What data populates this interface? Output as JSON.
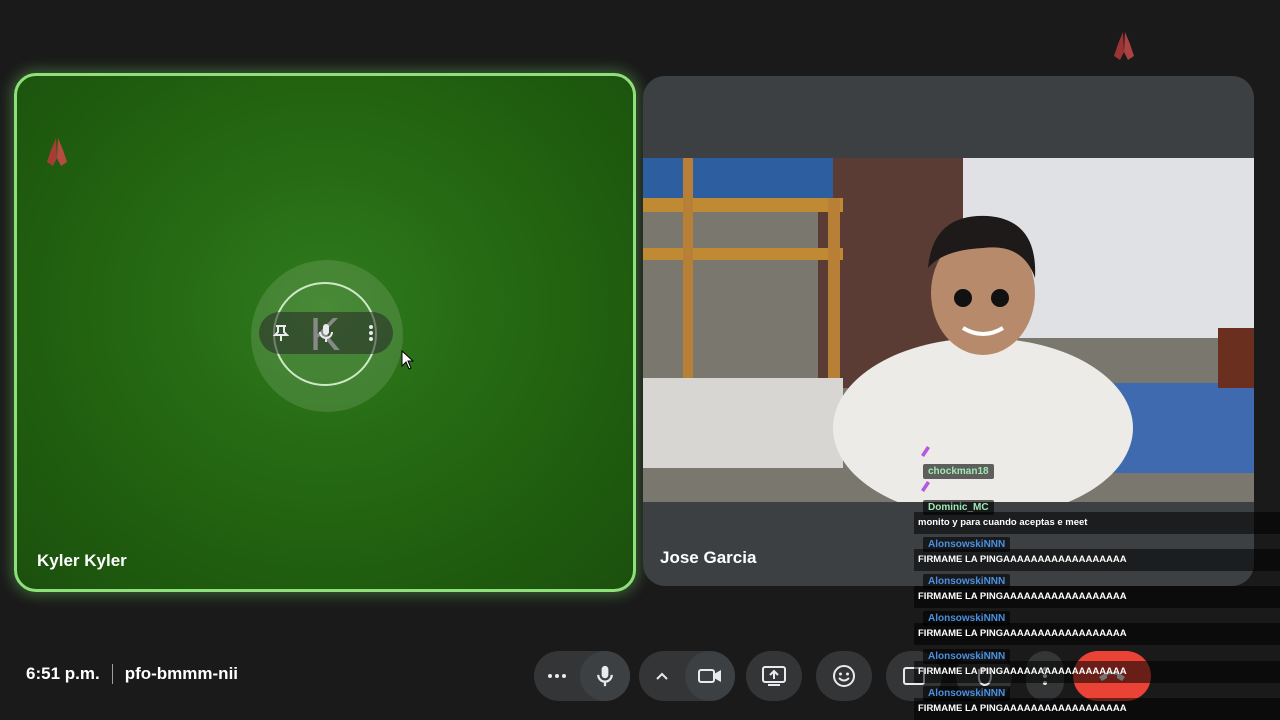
{
  "participants": [
    {
      "name": "Kyler Kyler",
      "initial": "K"
    },
    {
      "name": "Jose Garcia"
    }
  ],
  "meeting": {
    "time": "6:51 p.m.",
    "code": "pfo-bmmm-nii"
  },
  "chat": [
    {
      "user": "chockman18",
      "user_color": "#9fe8b4",
      "message": ""
    },
    {
      "user": "Dominic_MC",
      "user_color": "#9fe8b4",
      "message": "monito y para cuando aceptas e meet"
    },
    {
      "user": "AlonsowskiNNN",
      "user_color": "#4a90e2",
      "message": "FIRMAME LA PINGAAAAAAAAAAAAAAAAAA"
    },
    {
      "user": "AlonsowskiNNN",
      "user_color": "#4a90e2",
      "message": "FIRMAME LA PINGAAAAAAAAAAAAAAAAAA"
    },
    {
      "user": "AlonsowskiNNN",
      "user_color": "#4a90e2",
      "message": "FIRMAME LA PINGAAAAAAAAAAAAAAAAAA"
    },
    {
      "user": "AlonsowskiNNN",
      "user_color": "#4a90e2",
      "message": "FIRMAME LA PINGAAAAAAAAAAAAAAAAAA"
    },
    {
      "user": "AlonsowskiNNN",
      "user_color": "#4a90e2",
      "message": "FIRMAME LA PINGAAAAAAAAAAAAAAAAAA"
    }
  ],
  "colors": {
    "speaking_border": "#8ee07a",
    "end_call": "#ea4335",
    "control_bg": "#333537",
    "reaction": "#b23a3a"
  },
  "icons": {
    "reaction": "praying-hands-icon",
    "pin": "pin-icon",
    "mic": "mic-icon",
    "more": "more-vert-icon"
  }
}
